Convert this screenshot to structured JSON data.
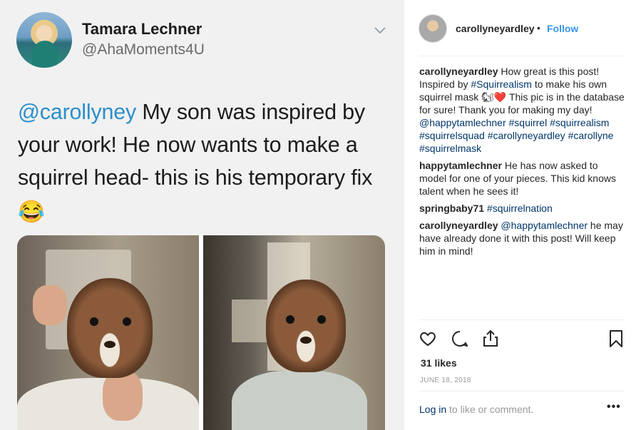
{
  "tweet": {
    "name": "Tamara Lechner",
    "handle": "@AhaMoments4U",
    "mention": "@carollyney",
    "text": " My son was inspired by your work! He now wants to make a squirrel head- this is his temporary fix",
    "emoji": "😂"
  },
  "post": {
    "username": "carollyneyardley",
    "separator": "•",
    "follow_label": "Follow",
    "comments": [
      {
        "user": "carollyneyardley",
        "parts": [
          {
            "t": " How great is this post! Inspired by "
          },
          {
            "t": "#Squirrealism",
            "tag": true
          },
          {
            "t": " to make his own squirrel mask 🐿❤️ This pic is in the database for sure! Thank you for making my day! "
          },
          {
            "t": "@happytamlechner",
            "tag": true
          },
          {
            "t": " "
          },
          {
            "t": "#squirrel",
            "tag": true
          },
          {
            "t": " "
          },
          {
            "t": "#squirrealism",
            "tag": true
          },
          {
            "t": " "
          },
          {
            "t": "#squirrelsquad",
            "tag": true
          },
          {
            "t": " "
          },
          {
            "t": "#carollyneyardley",
            "tag": true
          },
          {
            "t": " "
          },
          {
            "t": "#carollyne",
            "tag": true
          },
          {
            "t": " "
          },
          {
            "t": "#squirrelmask",
            "tag": true
          }
        ]
      },
      {
        "user": "happytamlechner",
        "parts": [
          {
            "t": " He has now asked to model for one of your pieces. This kid knows talent when he sees it!"
          }
        ]
      },
      {
        "user": "springbaby71",
        "parts": [
          {
            "t": " "
          },
          {
            "t": "#squirrelnation",
            "tag": true
          }
        ]
      },
      {
        "user": "carollyneyardley",
        "parts": [
          {
            "t": " "
          },
          {
            "t": "@happytamlechner",
            "tag": true
          },
          {
            "t": " he may have already done it with this post! Will keep him in mind!"
          }
        ]
      }
    ],
    "likes": "31 likes",
    "date": "JUNE 18, 2018",
    "login_link": "Log in",
    "login_suffix": " to like or comment.",
    "more_label": "•••"
  },
  "icons": {
    "like": "heart-icon",
    "comment": "comment-bubble-icon",
    "share": "share-icon",
    "save": "bookmark-icon",
    "tweet_menu": "chevron-down-icon"
  },
  "colors": {
    "link_blue": "#3897f0",
    "tag_blue": "#003569",
    "twitter_blue": "#2b8fcc",
    "muted": "#999999"
  }
}
